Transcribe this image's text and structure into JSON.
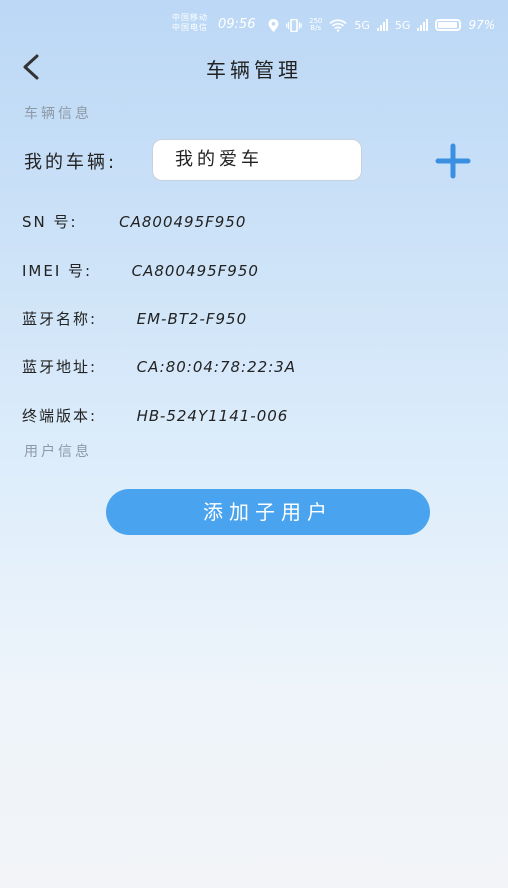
{
  "status_bar": {
    "carrier_1": "中国移动",
    "carrier_2": "中国电信",
    "time": "09:56",
    "net_speed_value": "250",
    "net_speed_unit": "B/s",
    "network_type_1": "5G",
    "network_type_2": "5G",
    "battery_percent": "97%"
  },
  "header": {
    "title": "车辆管理"
  },
  "vehicle_info": {
    "section_title": "车辆信息",
    "my_vehicle_label": "我的车辆:",
    "my_vehicle_value": "我的爱车",
    "fields": [
      {
        "label": "SN 号:",
        "value": "CA800495F950"
      },
      {
        "label": "IMEI 号:",
        "value": "CA800495F950"
      },
      {
        "label": "蓝牙名称:",
        "value": "EM-BT2-F950"
      },
      {
        "label": "蓝牙地址:",
        "value": "CA:80:04:78:22:3A"
      },
      {
        "label": "终端版本:",
        "value": "HB-524Y1141-006"
      }
    ]
  },
  "user_info": {
    "section_title": "用户信息",
    "add_user_label": "添加子用户"
  },
  "colors": {
    "accent": "#3a8fe0",
    "button": "#4aa3ee"
  },
  "icons": {
    "back": "chevron-left-icon",
    "add": "plus-icon",
    "location": "location-pin-icon",
    "vibrate": "vibrate-icon",
    "wifi": "wifi-icon"
  }
}
